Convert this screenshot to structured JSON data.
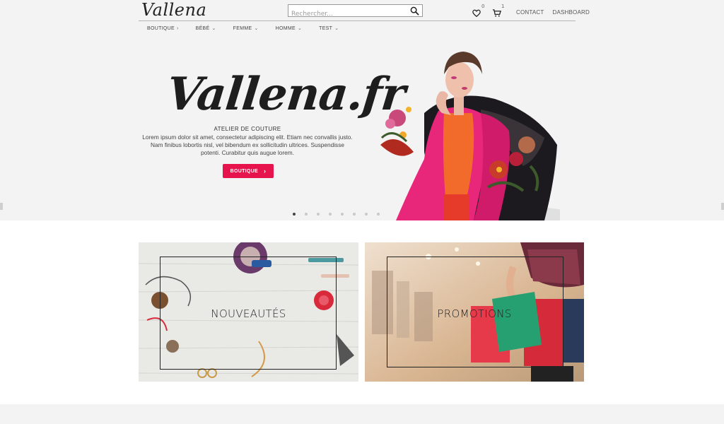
{
  "header": {
    "logo": "Vallena",
    "search_placeholder": "Rechercher...",
    "wishlist_count": "0",
    "cart_count": "1",
    "links": [
      "CONTACT",
      "DASHBOARD"
    ]
  },
  "nav": {
    "items": [
      {
        "label": "BOUTIQUE",
        "chevron": "›"
      },
      {
        "label": "BÉBÉ",
        "chevron": "⌄"
      },
      {
        "label": "FEMME",
        "chevron": "⌄"
      },
      {
        "label": "HOMME",
        "chevron": "⌄"
      },
      {
        "label": "TEST",
        "chevron": "⌄"
      }
    ]
  },
  "hero": {
    "logo": "Vallena.fr",
    "subtitle": "ATELIER DE COUTURE",
    "text": "Lorem ipsum dolor sit amet, consectetur adipiscing elit. Etiam nec convallis justo. Nam finibus lobortis nisl, vel bibendum ex sollicitudin ultrices. Suspendisse potenti. Curabitur quis augue lorem.",
    "cta_label": "BOUTIQUE",
    "cta_chevron": "›",
    "slides": 8,
    "active_slide": 0,
    "accent": "#e6134d"
  },
  "categories": [
    {
      "title": "NOUVEAUTÉS"
    },
    {
      "title": "PROMOTIONS"
    }
  ],
  "icons": {
    "search": "search-icon",
    "wishlist": "heart-icon",
    "cart": "cart-icon"
  }
}
